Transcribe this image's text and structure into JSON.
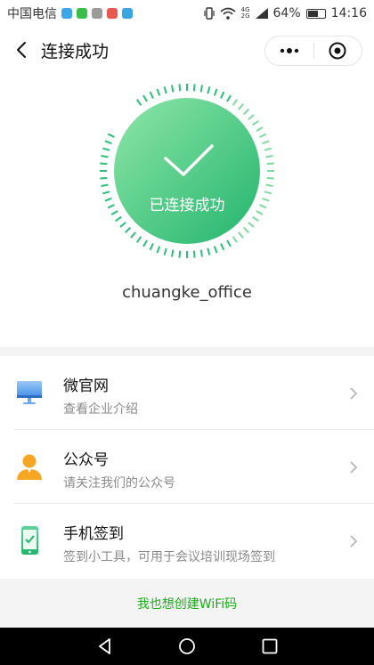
{
  "status_bar": {
    "carrier": "中国电信",
    "network_top": "4G",
    "network_bottom": "2G",
    "battery": "64%",
    "battery_level": 0.64,
    "time": "14:16"
  },
  "nav": {
    "title": "连接成功"
  },
  "result": {
    "status_text": "已连接成功",
    "ssid": "chuangke_office",
    "accent_color": "#2bbf7a"
  },
  "list": {
    "items": [
      {
        "title": "微官网",
        "subtitle": "查看企业介绍",
        "icon": "monitor-icon"
      },
      {
        "title": "公众号",
        "subtitle": "请关注我们的公众号",
        "icon": "person-icon"
      },
      {
        "title": "手机签到",
        "subtitle": "签到小工具，可用于会议培训现场签到",
        "icon": "phone-check-icon"
      }
    ]
  },
  "footer": {
    "link": "我也想创建WiFi码"
  }
}
